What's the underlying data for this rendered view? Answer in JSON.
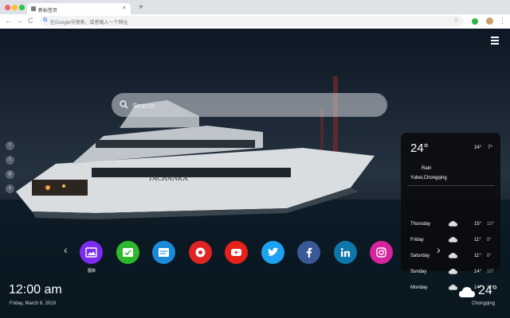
{
  "browser": {
    "tab_title": "新标签页",
    "tab_close": "×",
    "new_tab": "+",
    "back": "←",
    "forward": "→",
    "reload": "C",
    "omnibox_placeholder": "在Google中搜索，或者输入一个网址",
    "google_g": "G",
    "bookmark_star": "☆",
    "menu": "⋮"
  },
  "search": {
    "placeholder": "Search"
  },
  "social_links": [
    {
      "icon": "facebook-icon",
      "glyph": "f"
    },
    {
      "icon": "twitter-icon",
      "glyph": "t"
    },
    {
      "icon": "pinterest-icon",
      "glyph": "p"
    },
    {
      "icon": "share-icon",
      "glyph": "s"
    }
  ],
  "weather_panel": {
    "temp": "24°",
    "high": "24°",
    "low": "7°",
    "condition": "Rain",
    "location": "Yubei,Chongqing",
    "forecast": [
      {
        "day": "Thursday",
        "high": "15°",
        "low": "10°"
      },
      {
        "day": "Friday",
        "high": "11°",
        "low": "8°"
      },
      {
        "day": "Saturday",
        "high": "11°",
        "low": "8°"
      },
      {
        "day": "Sunday",
        "high": "14°",
        "low": "10°"
      },
      {
        "day": "Monday",
        "high": "14°",
        "low": "10°"
      }
    ]
  },
  "apps": [
    {
      "icon": "gallery-icon",
      "label": "图库",
      "color": "#7b2cf0"
    },
    {
      "icon": "check-icon",
      "label": "",
      "color": "#2eb82e"
    },
    {
      "icon": "notes-icon",
      "label": "",
      "color": "#1c8adb"
    },
    {
      "icon": "games-icon",
      "label": "",
      "color": "#e02424"
    },
    {
      "icon": "youtube-icon",
      "label": "",
      "color": "#e62117"
    },
    {
      "icon": "twitter-icon",
      "label": "",
      "color": "#1da1f2"
    },
    {
      "icon": "facebook-icon",
      "label": "",
      "color": "#3b5998"
    },
    {
      "icon": "linkedin-icon",
      "label": "",
      "color": "#0e76a8"
    },
    {
      "icon": "instagram-icon",
      "label": "",
      "color": "#d6249f"
    }
  ],
  "nav": {
    "prev": "‹",
    "next": "›"
  },
  "clock": {
    "time": "12:00 am",
    "date": "Friday, March 8, 2019"
  },
  "bottom_weather": {
    "temp": "24°",
    "city": "Chongqing"
  },
  "colors": {
    "panel_bg": "#0a0a0c",
    "accent_green": "#2db34a"
  }
}
